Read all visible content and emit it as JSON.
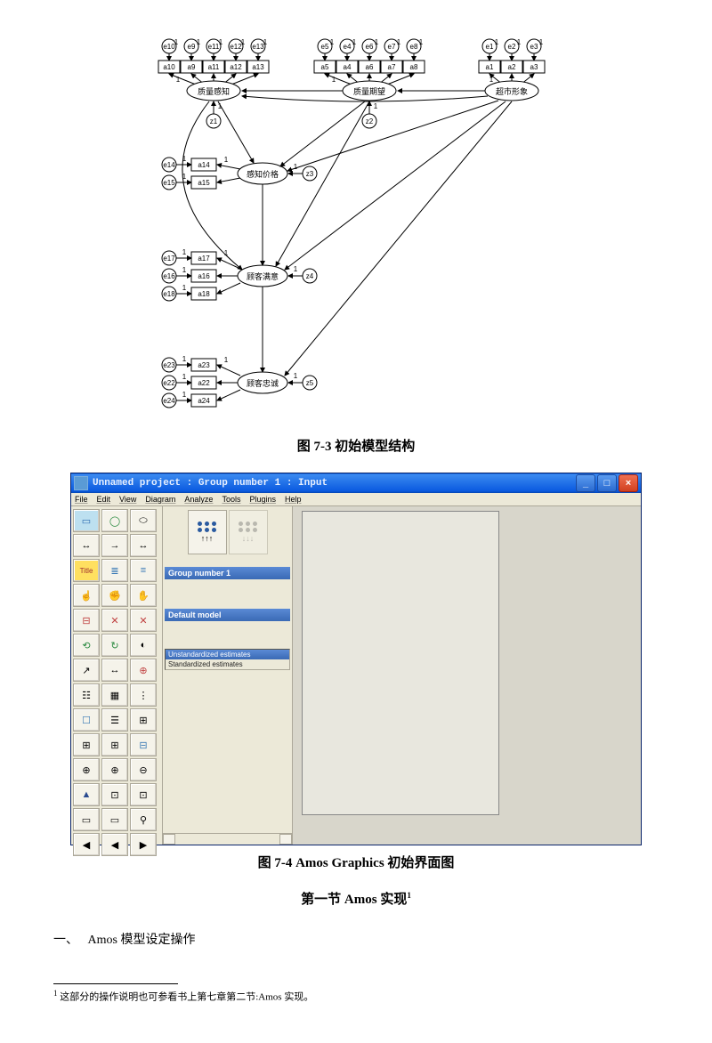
{
  "sem": {
    "top_errors": [
      "e10",
      "e9",
      "e11",
      "e12",
      "e13",
      "e5",
      "e4",
      "e6",
      "e7",
      "e8",
      "e1",
      "e2",
      "e3"
    ],
    "top_indicators": [
      "a10",
      "a9",
      "a11",
      "a12",
      "a13",
      "a5",
      "a4",
      "a6",
      "a7",
      "a8",
      "a1",
      "a2",
      "a3"
    ],
    "latent_top": [
      "质量感知",
      "质量期望",
      "超市形象"
    ],
    "latent_disturb": [
      "z1",
      "z2",
      "",
      "z3",
      "z4",
      "z5"
    ],
    "mid1": {
      "errors": [
        "e14",
        "e15"
      ],
      "indicators": [
        "a14",
        "a15"
      ],
      "latent": "感知价格"
    },
    "mid2": {
      "errors": [
        "e17",
        "e16",
        "e18"
      ],
      "indicators": [
        "a17",
        "a16",
        "a18"
      ],
      "latent": "顾客满意"
    },
    "mid3": {
      "errors": [
        "e23",
        "e22",
        "e24"
      ],
      "indicators": [
        "a23",
        "a22",
        "a24"
      ],
      "latent": "顾客忠诚"
    },
    "weight": "1"
  },
  "captions": {
    "fig73": "图 7-3    初始模型结构",
    "fig74": "图 7-4    Amos Graphics 初始界面图",
    "section": "第一节    Amos 实现"
  },
  "amos": {
    "title": "Unnamed project : Group number 1 : Input",
    "menus": [
      "File",
      "Edit",
      "View",
      "Diagram",
      "Analyze",
      "Tools",
      "Plugins",
      "Help"
    ],
    "group_label": "Group number 1",
    "model_label": "Default model",
    "est_sel": "Unstandardized estimates",
    "est_other": "Standardized estimates",
    "tools": {
      "r1": [
        "▭",
        "◯",
        "⬭"
      ],
      "r2": [
        "↔",
        "→",
        "↔"
      ],
      "r3": [
        "Title",
        "≣",
        "≡"
      ],
      "r4": [
        "☝",
        "✊",
        "✋"
      ],
      "r5": [
        "⊟",
        "✕",
        "✕"
      ],
      "r6": [
        "⟲",
        "↻",
        "◐"
      ],
      "r7": [
        "↗",
        "↔",
        "⊕"
      ],
      "r8": [
        "☷",
        "▦",
        "⋮"
      ],
      "r9": [
        "☐",
        "☰",
        "⊞"
      ],
      "r10": [
        "⊞",
        "⊞",
        "⊟"
      ],
      "r11": [
        "⊕",
        "⊕",
        "⊖"
      ],
      "r12": [
        "▲",
        "⊡",
        "⊡"
      ],
      "r13": [
        "▭",
        "▭",
        "⚲"
      ],
      "r14": [
        "◀",
        "◀",
        "▶"
      ]
    }
  },
  "body": {
    "heading1_prefix": "一、",
    "heading1": "Amos 模型设定操作"
  },
  "footnote": {
    "marker": "1",
    "text": "这部分的操作说明也可参看书上第七章第二节:Amos 实现。"
  }
}
